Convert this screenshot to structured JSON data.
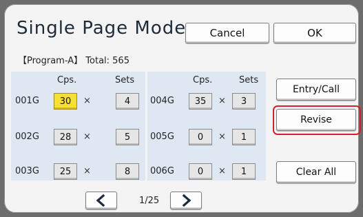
{
  "title": "Single Page Mode",
  "buttons": {
    "cancel": "Cancel",
    "ok": "OK"
  },
  "status": "【Program-A】 Total: 565",
  "headers": {
    "copies": "Cps.",
    "sets": "Sets"
  },
  "times_symbol": "×",
  "groups": [
    {
      "label": "001G",
      "copies": "30",
      "sets": "4",
      "selected": true
    },
    {
      "label": "002G",
      "copies": "28",
      "sets": "5"
    },
    {
      "label": "003G",
      "copies": "25",
      "sets": "8"
    },
    {
      "label": "004G",
      "copies": "35",
      "sets": "3"
    },
    {
      "label": "005G",
      "copies": "0",
      "sets": "1"
    },
    {
      "label": "006G",
      "copies": "0",
      "sets": "1"
    }
  ],
  "side_buttons": {
    "entry_call": "Entry/Call",
    "revise": "Revise",
    "clear_all": "Clear All"
  },
  "pagination": {
    "indicator": "1/25",
    "prev_icon": "chevron-left-icon",
    "next_icon": "chevron-right-icon"
  },
  "colors": {
    "accent_navy": "#1c2a3a",
    "selected_field": "#f8df33",
    "highlight_ring": "#d4202c",
    "panel": "#dfe8f2"
  }
}
